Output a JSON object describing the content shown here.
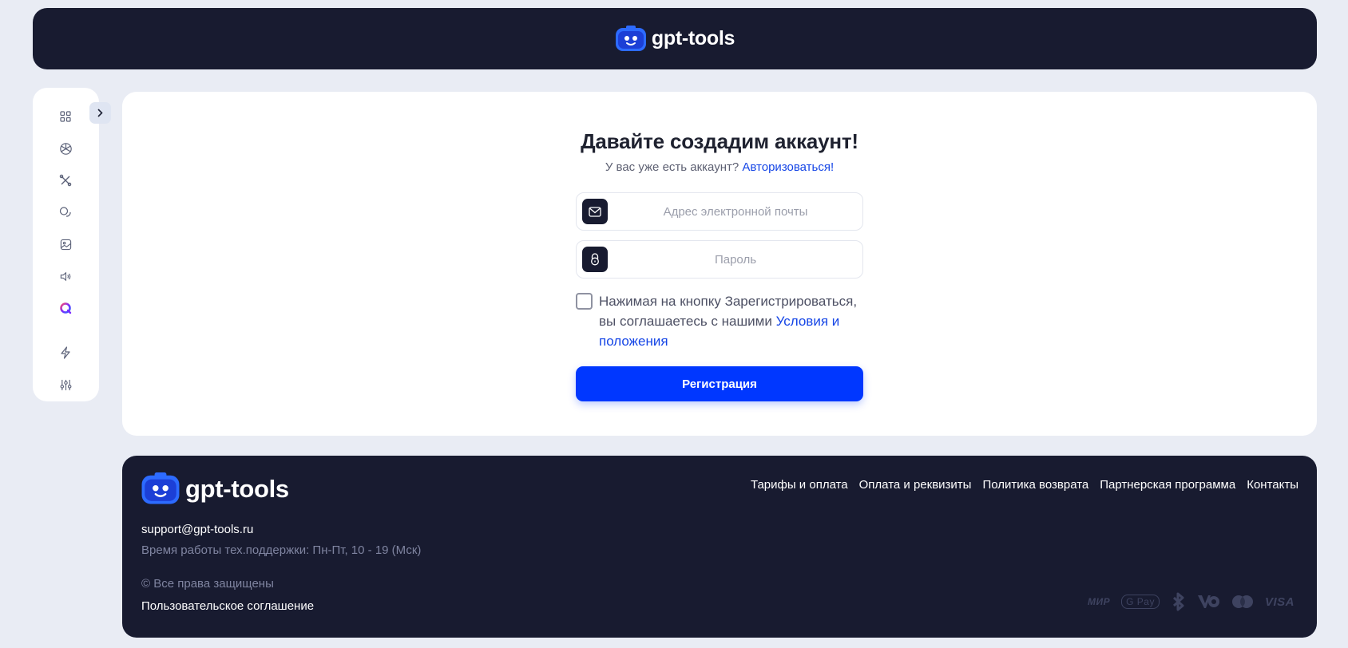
{
  "header": {
    "brand": "gpt-tools"
  },
  "sidebar": {
    "items": [
      {
        "icon": "apps-grid-icon"
      },
      {
        "icon": "openai-icon"
      },
      {
        "icon": "tools-icon"
      },
      {
        "icon": "chat-bubbles-icon"
      },
      {
        "icon": "image-icon"
      },
      {
        "icon": "audio-icon"
      },
      {
        "icon": "brand-q-icon"
      },
      {
        "icon": "lightning-icon"
      },
      {
        "icon": "settings-sliders-icon"
      }
    ],
    "expand_icon": "chevron-right-icon"
  },
  "form": {
    "title": "Давайте создадим аккаунт!",
    "subtitle_text": "У вас уже есть аккаунт?",
    "login_link": "Авторизоваться!",
    "email_placeholder": "Адрес электронной почты",
    "password_placeholder": "Пароль",
    "consent_text": "Нажимая на кнопку Зарегистрироваться, вы соглашаетесь с нашими",
    "terms_link": "Условия и положения",
    "submit_label": "Регистрация"
  },
  "footer": {
    "brand": "gpt-tools",
    "nav": [
      "Тарифы и оплата",
      "Оплата и реквизиты",
      "Политика возврата",
      "Партнерская программа",
      "Контакты"
    ],
    "email": "support@gpt-tools.ru",
    "hours": "Время работы тех.поддержки: Пн-Пт, 10 - 19 (Мск)",
    "rights": "© Все права защищены",
    "agreement": "Пользовательское соглашение",
    "payments": [
      "МИР",
      "G Pay",
      "VISA"
    ]
  },
  "colors": {
    "dark": "#181b30",
    "accent": "#0037ff",
    "link": "#1545e6",
    "background": "#e9ecf4"
  }
}
